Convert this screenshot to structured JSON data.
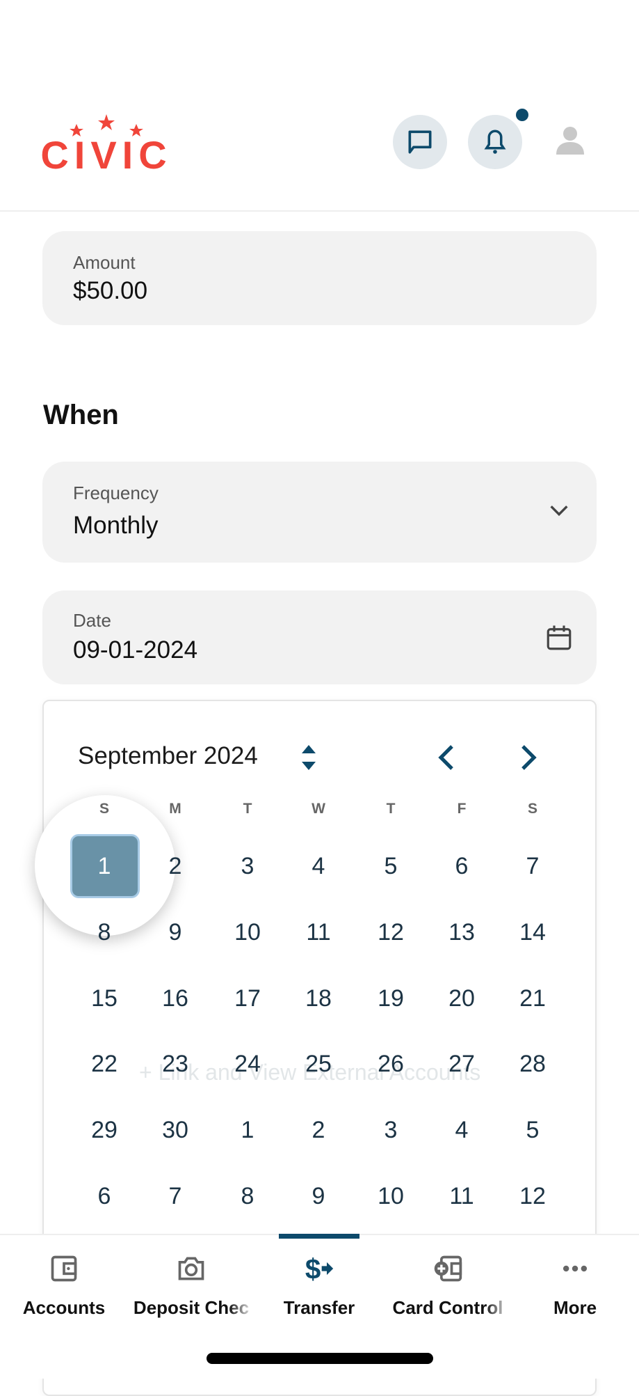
{
  "header": {
    "logo_text": "CIVIC",
    "brand_color": "#f0453a",
    "accent_color": "#0d4a6b",
    "icons": [
      "chat-icon",
      "bell-icon",
      "user-icon"
    ],
    "has_notification": true
  },
  "amount": {
    "label": "Amount",
    "value": "$50.00"
  },
  "when": {
    "heading": "When"
  },
  "frequency": {
    "label": "Frequency",
    "value": "Monthly"
  },
  "date": {
    "label": "Date",
    "value": "09-01-2024"
  },
  "calendar": {
    "month_label": "September 2024",
    "weekdays": [
      "S",
      "M",
      "T",
      "W",
      "T",
      "F",
      "S"
    ],
    "weeks": [
      [
        "1",
        "2",
        "3",
        "4",
        "5",
        "6",
        "7"
      ],
      [
        "8",
        "9",
        "10",
        "11",
        "12",
        "13",
        "14"
      ],
      [
        "15",
        "16",
        "17",
        "18",
        "19",
        "20",
        "21"
      ],
      [
        "22",
        "23",
        "24",
        "25",
        "26",
        "27",
        "28"
      ],
      [
        "29",
        "30",
        "1",
        "2",
        "3",
        "4",
        "5"
      ],
      [
        "6",
        "7",
        "8",
        "9",
        "10",
        "11",
        "12"
      ]
    ],
    "selected": "1"
  },
  "background_link": "+ Link and View External Accounts",
  "nav": {
    "items": [
      {
        "label": "Accounts",
        "icon": "wallet-icon"
      },
      {
        "label": "Deposit Chec",
        "icon": "camera-icon"
      },
      {
        "label": "Transfer",
        "icon": "dollar-transfer-icon",
        "active": true
      },
      {
        "label": "Card Control",
        "icon": "card-controls-icon"
      },
      {
        "label": "More",
        "icon": "more-icon"
      }
    ]
  }
}
